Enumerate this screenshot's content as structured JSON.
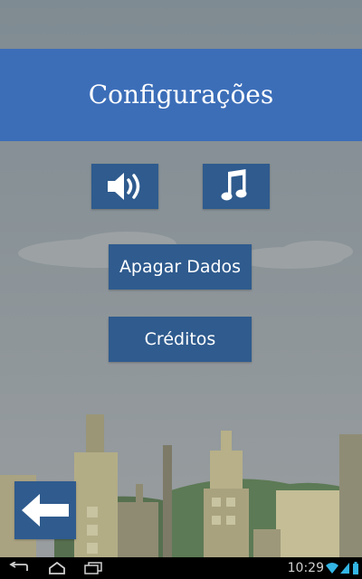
{
  "screen": {
    "title": "Configurações"
  },
  "buttons": {
    "sound_icon": "speaker-icon",
    "music_icon": "music-note-icon",
    "clear_data_label": "Apagar Dados",
    "credits_label": "Créditos",
    "back_icon": "back-arrow-icon"
  },
  "status_bar": {
    "time": "10:29"
  },
  "colors": {
    "header": "#3c6eb8",
    "button": "#2f5b8e",
    "sky": "#8d9498"
  }
}
